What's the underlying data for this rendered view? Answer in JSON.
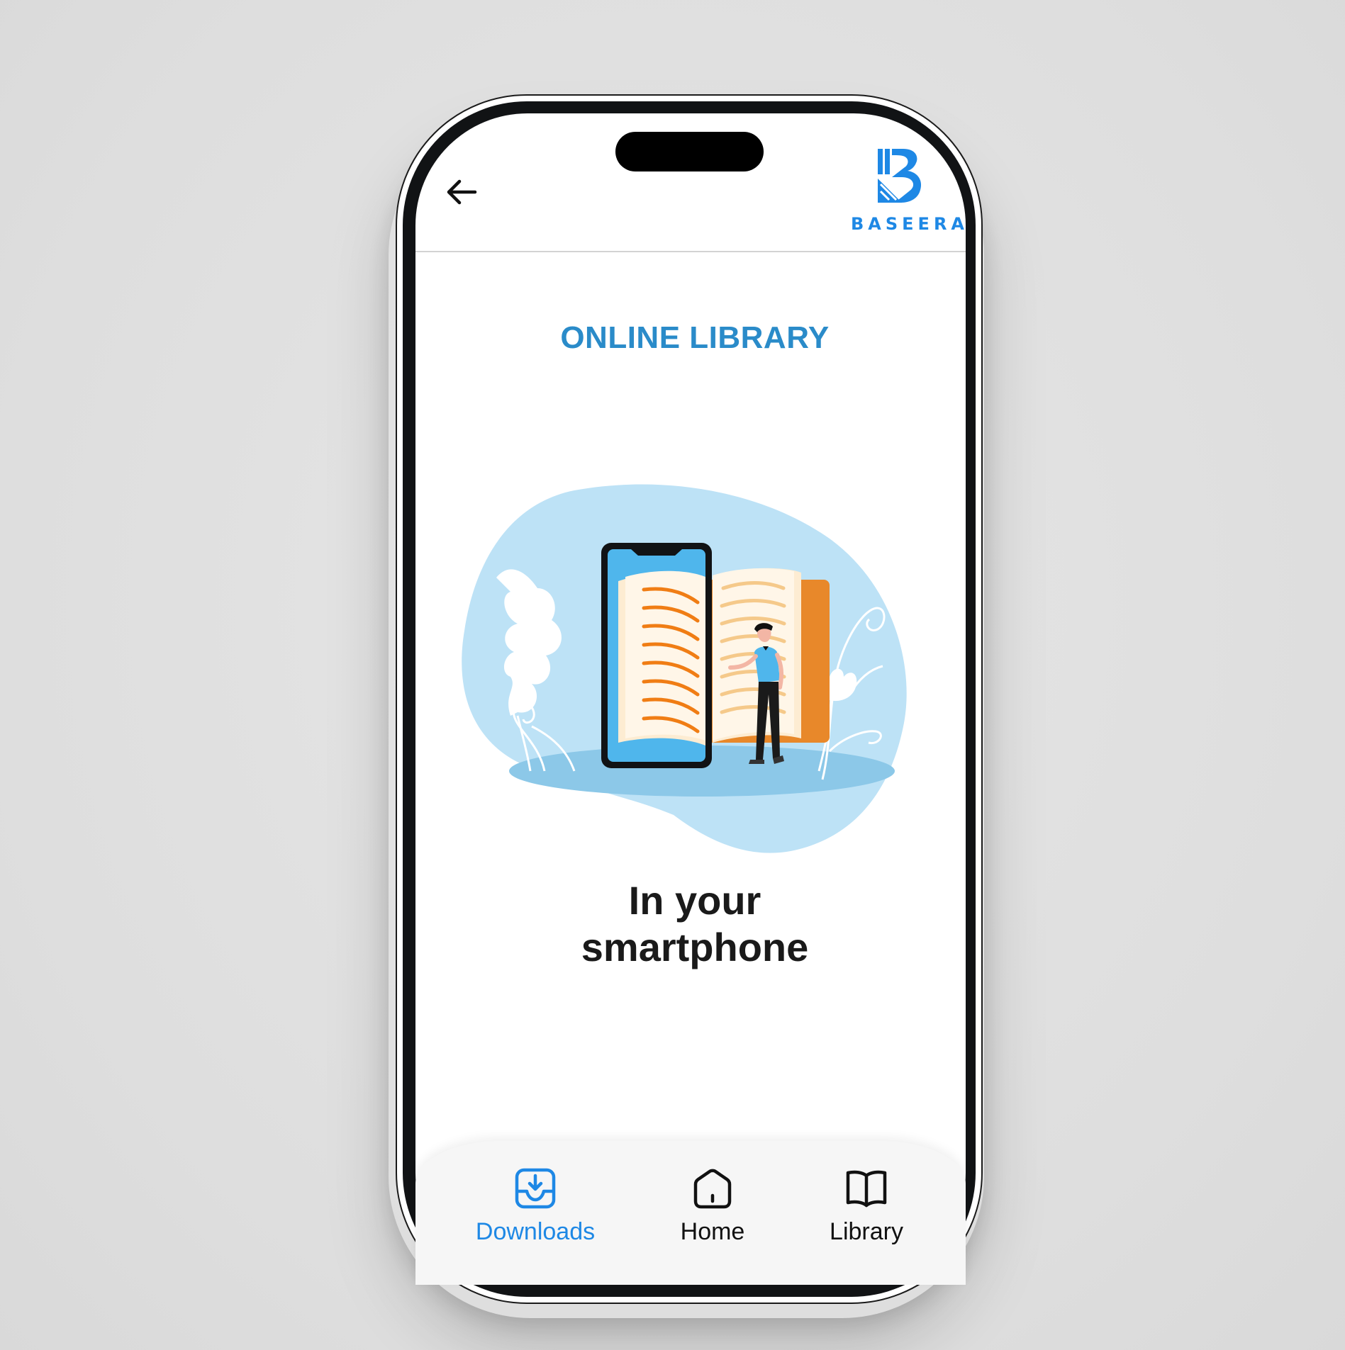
{
  "header": {
    "back_icon": "arrow-left-icon",
    "logo": {
      "icon": "baseera-logo-mark",
      "text": "BASEERA",
      "color": "#1e88e5"
    }
  },
  "main": {
    "title": "ONLINE LIBRARY",
    "title_color": "#2a8bc9",
    "illustration": "smartphone-open-book-illustration",
    "subtitle_line1": "In your",
    "subtitle_line2": "smartphone"
  },
  "bottom_nav": {
    "active": "downloads",
    "active_color": "#1e88e5",
    "items": [
      {
        "id": "downloads",
        "label": "Downloads",
        "icon": "download-tray-icon"
      },
      {
        "id": "home",
        "label": "Home",
        "icon": "home-icon"
      },
      {
        "id": "library",
        "label": "Library",
        "icon": "open-book-icon"
      }
    ]
  }
}
